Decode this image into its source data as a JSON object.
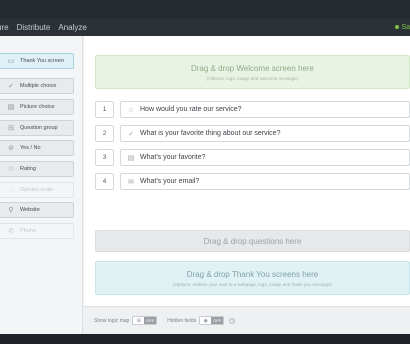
{
  "nav": {
    "items": [
      "ure",
      "Distribute",
      "Analyze"
    ],
    "status": "Sa"
  },
  "sidebar": {
    "items": [
      {
        "label": "Thank You screen",
        "icon": "▭",
        "icon_name": "screen-icon",
        "state": "active"
      },
      {
        "label": "Multiple choice",
        "icon": "✓",
        "icon_name": "checkmark-icon",
        "state": "normal"
      },
      {
        "label": "Picture choice",
        "icon": "▤",
        "icon_name": "picture-icon",
        "state": "normal"
      },
      {
        "label": "Question group",
        "icon": "⊟",
        "icon_name": "group-icon",
        "state": "normal"
      },
      {
        "label": "Yes / No",
        "icon": "⊘",
        "icon_name": "yes-no-icon",
        "state": "normal"
      },
      {
        "label": "Rating",
        "icon": "☆",
        "icon_name": "star-icon",
        "state": "normal"
      },
      {
        "label": "Opinion scale",
        "icon": "◌",
        "icon_name": "scale-icon",
        "state": "disabled"
      },
      {
        "label": "Website",
        "icon": "⚲",
        "icon_name": "link-icon",
        "state": "normal"
      },
      {
        "label": "Phone",
        "icon": "✆",
        "icon_name": "phone-icon",
        "state": "disabled"
      }
    ]
  },
  "welcome": {
    "title": "Drag & drop Welcome screen here",
    "subtitle": "(Options: logo, image and welcome message)"
  },
  "questions": [
    {
      "number": "1",
      "icon": "☆",
      "icon_name": "star-icon",
      "text": "How would you rate our service?"
    },
    {
      "number": "2",
      "icon": "✓",
      "icon_name": "checkmark-icon",
      "text": "What is your favorite thing about our service?"
    },
    {
      "number": "3",
      "icon": "▤",
      "icon_name": "picture-icon",
      "text": "What's your favorite?"
    },
    {
      "number": "4",
      "icon": "✉",
      "icon_name": "email-icon",
      "text": "What's your email?"
    }
  ],
  "questions_dropzone": {
    "title": "Drag & drop questions here"
  },
  "thanks": {
    "title": "Drag & drop Thank You screens here",
    "subtitle": "(Options: redirect your user to a webpage, logo, image and thank you message)"
  },
  "footer": {
    "logic_map_label": "Show logic map",
    "logic_map_state": "OFF",
    "hidden_fields_label": "Hidden fields",
    "hidden_fields_state": "OFF",
    "help_icon": "?"
  },
  "colors": {
    "status": "#7ec544",
    "active_item": "#dff1f6",
    "welcome_zone": "#e9f3e3",
    "thanks_zone": "#e1f2f4"
  }
}
